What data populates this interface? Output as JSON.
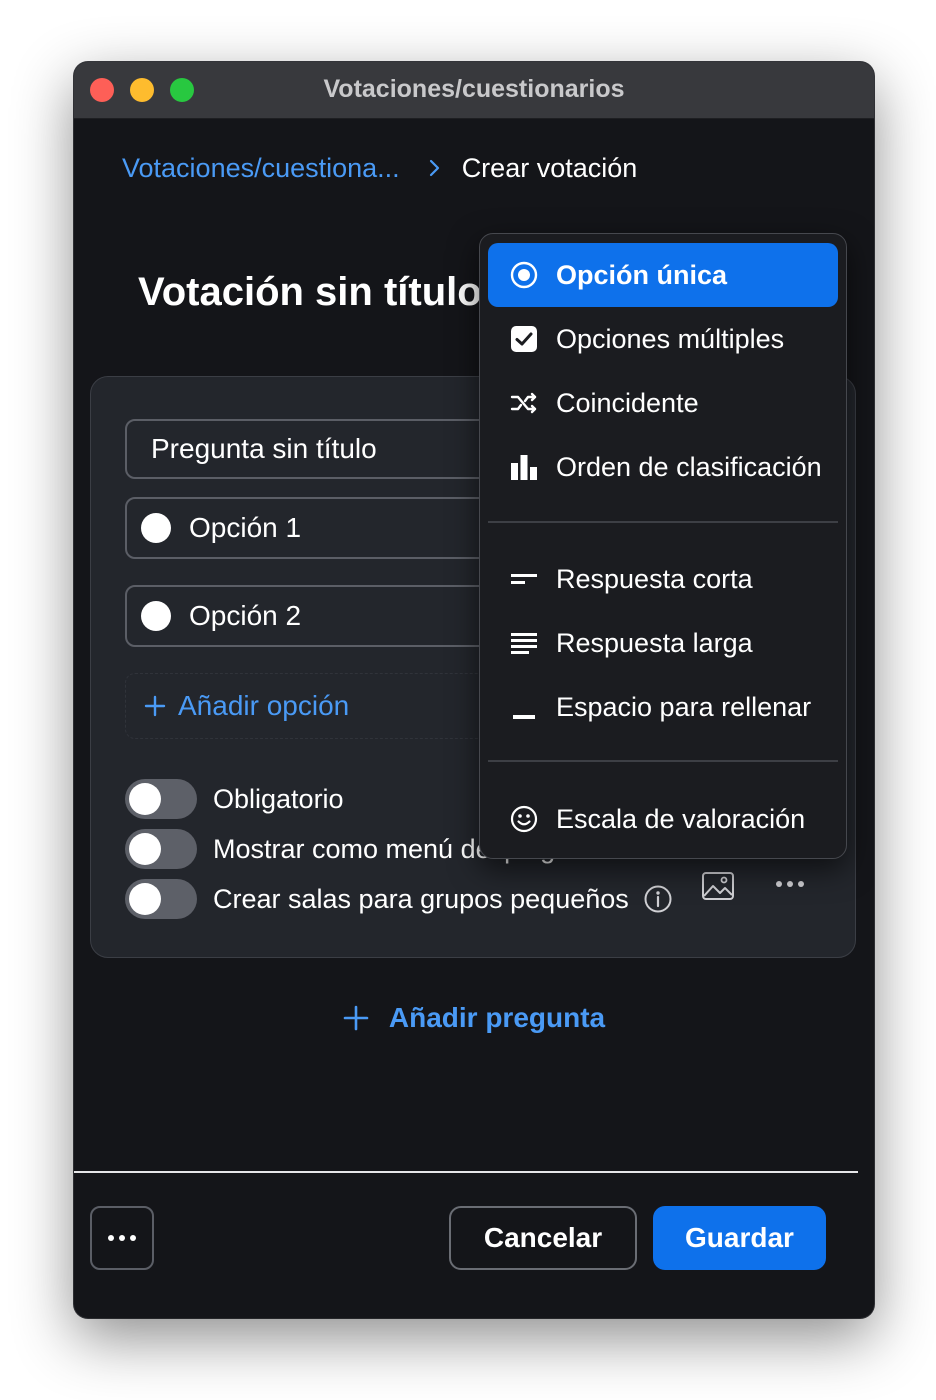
{
  "window": {
    "title": "Votaciones/cuestionarios"
  },
  "breadcrumb": {
    "parent": "Votaciones/cuestiona...",
    "current": "Crear votación"
  },
  "poll": {
    "title": "Votación sin título 1"
  },
  "question": {
    "placeholder": "Pregunta sin título",
    "options": [
      "Opción 1",
      "Opción 2"
    ],
    "add_option_label": "Añadir opción"
  },
  "toggles": [
    {
      "label": "Obligatorio",
      "on": false
    },
    {
      "label": "Mostrar como menú desplegable",
      "on": false
    },
    {
      "label": "Crear salas para grupos pequeños",
      "on": false
    }
  ],
  "add_question_label": "Añadir pregunta",
  "footer": {
    "cancel_label": "Cancelar",
    "save_label": "Guardar"
  },
  "question_type_menu": {
    "items": [
      {
        "label": "Opción única",
        "icon": "radio-icon",
        "selected": true
      },
      {
        "label": "Opciones múltiples",
        "icon": "checkbox-icon",
        "selected": false
      },
      {
        "label": "Coincidente",
        "icon": "shuffle-icon",
        "selected": false
      },
      {
        "label": "Orden de clasificación",
        "icon": "bar-chart-icon",
        "selected": false
      },
      {
        "label": "Respuesta corta",
        "icon": "short-answer-icon",
        "selected": false
      },
      {
        "label": "Respuesta larga",
        "icon": "long-answer-icon",
        "selected": false
      },
      {
        "label": "Espacio para rellenar",
        "icon": "fill-blank-icon",
        "selected": false
      },
      {
        "label": "Escala de valoración",
        "icon": "smiley-icon",
        "selected": false
      }
    ]
  },
  "colors": {
    "accent": "#0e71eb",
    "link": "#4a9af5",
    "window_bg": "#141519",
    "card_bg": "#23262c",
    "menu_bg": "#1b1c20"
  }
}
